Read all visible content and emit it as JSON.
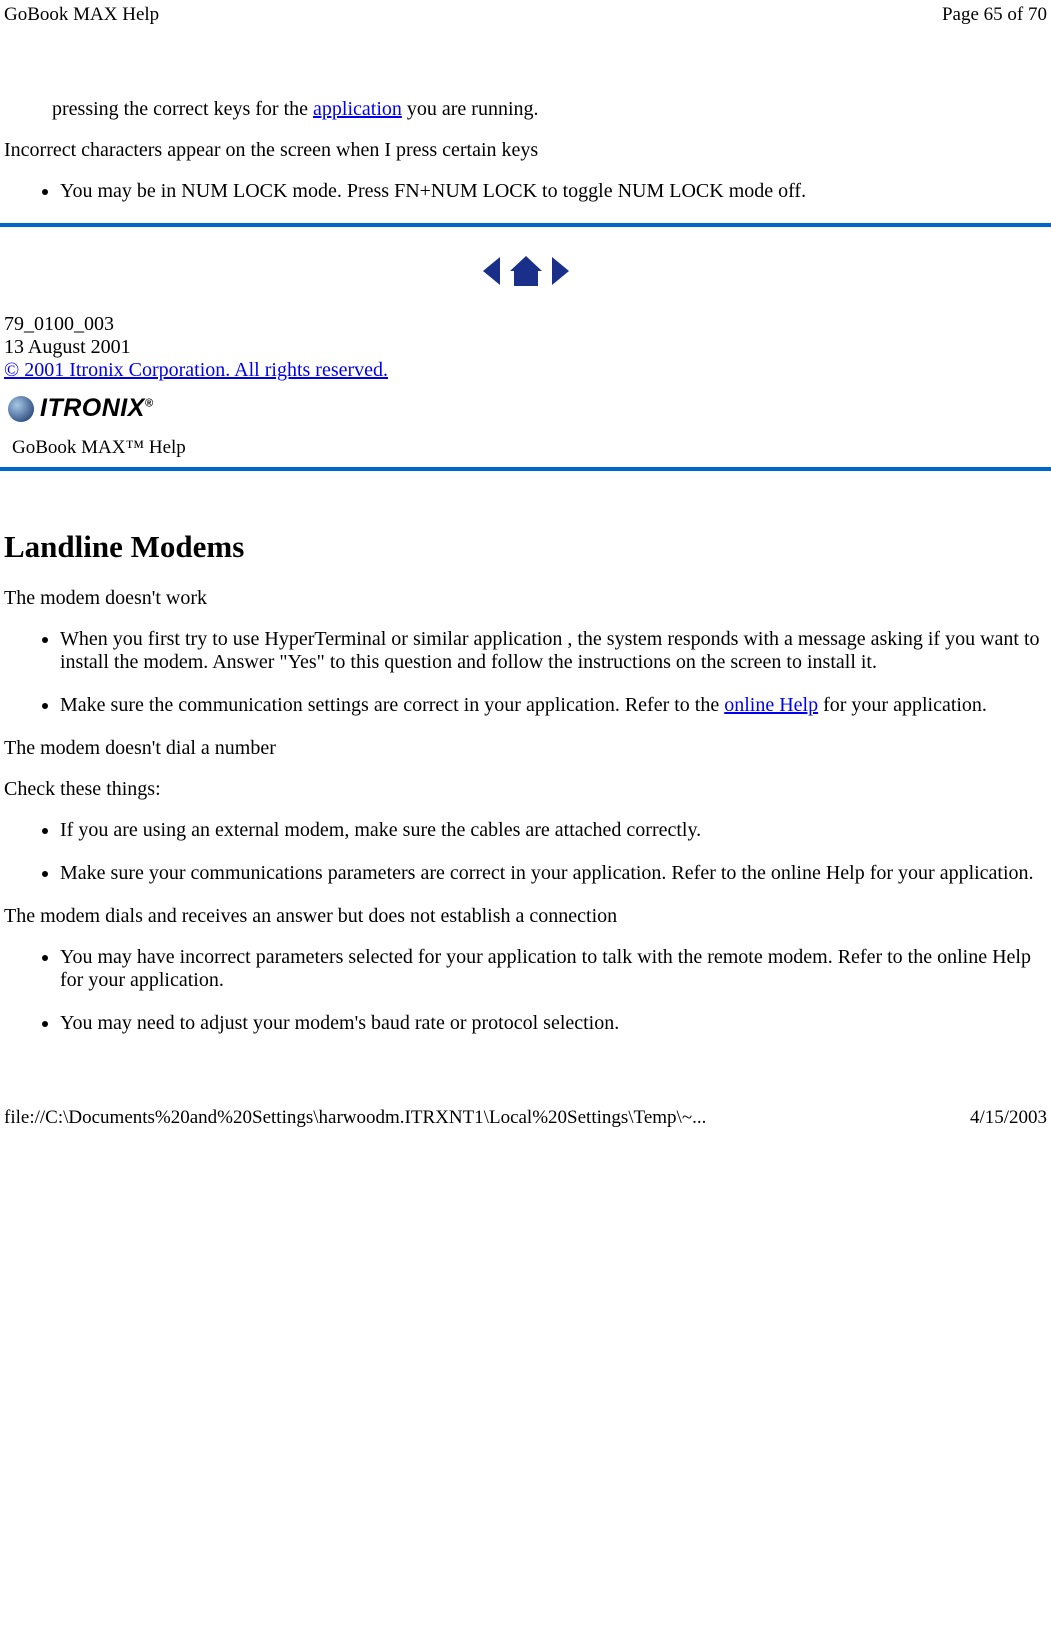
{
  "header": {
    "title": "GoBook MAX Help",
    "page": "Page 65 of 70"
  },
  "section1": {
    "line1_prefix": "pressing the correct keys for the ",
    "line1_link": "application",
    "line1_suffix": " you are running.",
    "p2": "Incorrect characters appear on the screen when I press certain keys",
    "bullet1": "You may be in NUM LOCK mode. Press FN+NUM LOCK to toggle NUM LOCK mode off."
  },
  "docinfo": {
    "docnum": "79_0100_003",
    "date": "13 August 2001",
    "copyright": "© 2001 Itronix Corporation.  All rights reserved."
  },
  "logo": {
    "brand": "ITRONIX",
    "sub": "GoBook MAX™ Help"
  },
  "section2": {
    "heading": "Landline Modems",
    "p1": "The modem doesn't work",
    "b1": "When you first try to use HyperTerminal or similar application , the system responds with a message asking if you want to install the modem. Answer \"Yes\" to this question and follow the instructions on the screen to install it.",
    "b2_prefix": "Make sure the communication settings are correct in your application. Refer to the ",
    "b2_link": "online Help",
    "b2_suffix": " for your application.",
    "p2": "The modem doesn't dial a number",
    "p3": "Check these things:",
    "b3": "If you are using an external modem, make sure the cables are attached correctly.",
    "b4": "Make sure your communications parameters are correct in your application. Refer to the online Help for your application.",
    "p4": "The modem dials and receives an answer but does not establish a connection",
    "b5": "You may have incorrect parameters selected for your application to talk with the remote modem. Refer to the online Help for your application.",
    "b6": "You may need to adjust your modem's baud rate or protocol selection."
  },
  "footer": {
    "path": "file://C:\\Documents%20and%20Settings\\harwoodm.ITRXNT1\\Local%20Settings\\Temp\\~...",
    "date": "4/15/2003"
  }
}
